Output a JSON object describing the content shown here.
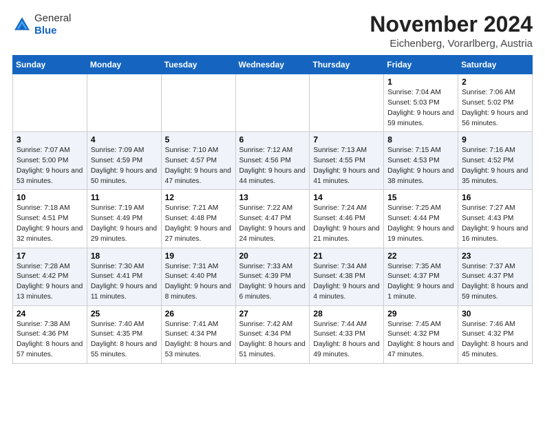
{
  "logo": {
    "general": "General",
    "blue": "Blue"
  },
  "header": {
    "month": "November 2024",
    "location": "Eichenberg, Vorarlberg, Austria"
  },
  "days_of_week": [
    "Sunday",
    "Monday",
    "Tuesday",
    "Wednesday",
    "Thursday",
    "Friday",
    "Saturday"
  ],
  "weeks": [
    [
      {
        "day": "",
        "info": ""
      },
      {
        "day": "",
        "info": ""
      },
      {
        "day": "",
        "info": ""
      },
      {
        "day": "",
        "info": ""
      },
      {
        "day": "",
        "info": ""
      },
      {
        "day": "1",
        "info": "Sunrise: 7:04 AM\nSunset: 5:03 PM\nDaylight: 9 hours and 59 minutes."
      },
      {
        "day": "2",
        "info": "Sunrise: 7:06 AM\nSunset: 5:02 PM\nDaylight: 9 hours and 56 minutes."
      }
    ],
    [
      {
        "day": "3",
        "info": "Sunrise: 7:07 AM\nSunset: 5:00 PM\nDaylight: 9 hours and 53 minutes."
      },
      {
        "day": "4",
        "info": "Sunrise: 7:09 AM\nSunset: 4:59 PM\nDaylight: 9 hours and 50 minutes."
      },
      {
        "day": "5",
        "info": "Sunrise: 7:10 AM\nSunset: 4:57 PM\nDaylight: 9 hours and 47 minutes."
      },
      {
        "day": "6",
        "info": "Sunrise: 7:12 AM\nSunset: 4:56 PM\nDaylight: 9 hours and 44 minutes."
      },
      {
        "day": "7",
        "info": "Sunrise: 7:13 AM\nSunset: 4:55 PM\nDaylight: 9 hours and 41 minutes."
      },
      {
        "day": "8",
        "info": "Sunrise: 7:15 AM\nSunset: 4:53 PM\nDaylight: 9 hours and 38 minutes."
      },
      {
        "day": "9",
        "info": "Sunrise: 7:16 AM\nSunset: 4:52 PM\nDaylight: 9 hours and 35 minutes."
      }
    ],
    [
      {
        "day": "10",
        "info": "Sunrise: 7:18 AM\nSunset: 4:51 PM\nDaylight: 9 hours and 32 minutes."
      },
      {
        "day": "11",
        "info": "Sunrise: 7:19 AM\nSunset: 4:49 PM\nDaylight: 9 hours and 29 minutes."
      },
      {
        "day": "12",
        "info": "Sunrise: 7:21 AM\nSunset: 4:48 PM\nDaylight: 9 hours and 27 minutes."
      },
      {
        "day": "13",
        "info": "Sunrise: 7:22 AM\nSunset: 4:47 PM\nDaylight: 9 hours and 24 minutes."
      },
      {
        "day": "14",
        "info": "Sunrise: 7:24 AM\nSunset: 4:46 PM\nDaylight: 9 hours and 21 minutes."
      },
      {
        "day": "15",
        "info": "Sunrise: 7:25 AM\nSunset: 4:44 PM\nDaylight: 9 hours and 19 minutes."
      },
      {
        "day": "16",
        "info": "Sunrise: 7:27 AM\nSunset: 4:43 PM\nDaylight: 9 hours and 16 minutes."
      }
    ],
    [
      {
        "day": "17",
        "info": "Sunrise: 7:28 AM\nSunset: 4:42 PM\nDaylight: 9 hours and 13 minutes."
      },
      {
        "day": "18",
        "info": "Sunrise: 7:30 AM\nSunset: 4:41 PM\nDaylight: 9 hours and 11 minutes."
      },
      {
        "day": "19",
        "info": "Sunrise: 7:31 AM\nSunset: 4:40 PM\nDaylight: 9 hours and 8 minutes."
      },
      {
        "day": "20",
        "info": "Sunrise: 7:33 AM\nSunset: 4:39 PM\nDaylight: 9 hours and 6 minutes."
      },
      {
        "day": "21",
        "info": "Sunrise: 7:34 AM\nSunset: 4:38 PM\nDaylight: 9 hours and 4 minutes."
      },
      {
        "day": "22",
        "info": "Sunrise: 7:35 AM\nSunset: 4:37 PM\nDaylight: 9 hours and 1 minute."
      },
      {
        "day": "23",
        "info": "Sunrise: 7:37 AM\nSunset: 4:37 PM\nDaylight: 8 hours and 59 minutes."
      }
    ],
    [
      {
        "day": "24",
        "info": "Sunrise: 7:38 AM\nSunset: 4:36 PM\nDaylight: 8 hours and 57 minutes."
      },
      {
        "day": "25",
        "info": "Sunrise: 7:40 AM\nSunset: 4:35 PM\nDaylight: 8 hours and 55 minutes."
      },
      {
        "day": "26",
        "info": "Sunrise: 7:41 AM\nSunset: 4:34 PM\nDaylight: 8 hours and 53 minutes."
      },
      {
        "day": "27",
        "info": "Sunrise: 7:42 AM\nSunset: 4:34 PM\nDaylight: 8 hours and 51 minutes."
      },
      {
        "day": "28",
        "info": "Sunrise: 7:44 AM\nSunset: 4:33 PM\nDaylight: 8 hours and 49 minutes."
      },
      {
        "day": "29",
        "info": "Sunrise: 7:45 AM\nSunset: 4:32 PM\nDaylight: 8 hours and 47 minutes."
      },
      {
        "day": "30",
        "info": "Sunrise: 7:46 AM\nSunset: 4:32 PM\nDaylight: 8 hours and 45 minutes."
      }
    ]
  ]
}
